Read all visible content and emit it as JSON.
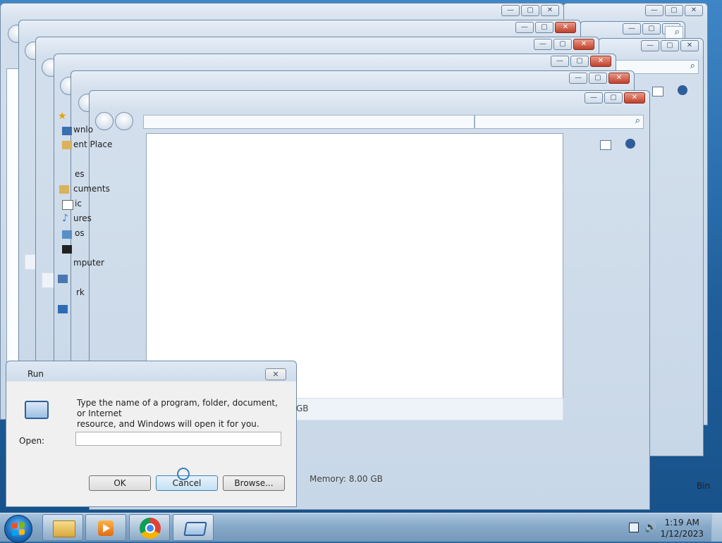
{
  "explorer": {
    "nav_pane_fragments": [
      "wnlo",
      "ent Place",
      "es",
      "cuments",
      "ic",
      "ures",
      "os",
      "mputer",
      "rk"
    ],
    "memory_label": "Memory:",
    "memory_value": "8.00 GB",
    "gb_fragment": "GB",
    "nav_glyph": "▾",
    "refresh_glyph": "↔",
    "search_glyph": "⌕"
  },
  "caption_buttons": {
    "minimize": "—",
    "maximize": "▢",
    "close": "✕"
  },
  "run_dialog": {
    "title": "Run",
    "description_line1": "Type the name of a program, folder, document, or Internet",
    "description_line2": "resource, and Windows will open it for you.",
    "open_label": "Open:",
    "input_value": "",
    "ok_label": "OK",
    "cancel_label": "Cancel",
    "browse_label": "Browse...",
    "close_glyph": "✕"
  },
  "desktop": {
    "recycle_bin_fragment": "Bin"
  },
  "taskbar": {
    "pinned": [
      "Windows Explorer",
      "Windows Media Player",
      "Google Chrome",
      "Run"
    ],
    "time": "1:19 AM",
    "date": "1/12/2023",
    "volume_glyph": "🔊"
  },
  "colors": {
    "accent": "#3f86c6",
    "close_red": "#c0402a"
  }
}
